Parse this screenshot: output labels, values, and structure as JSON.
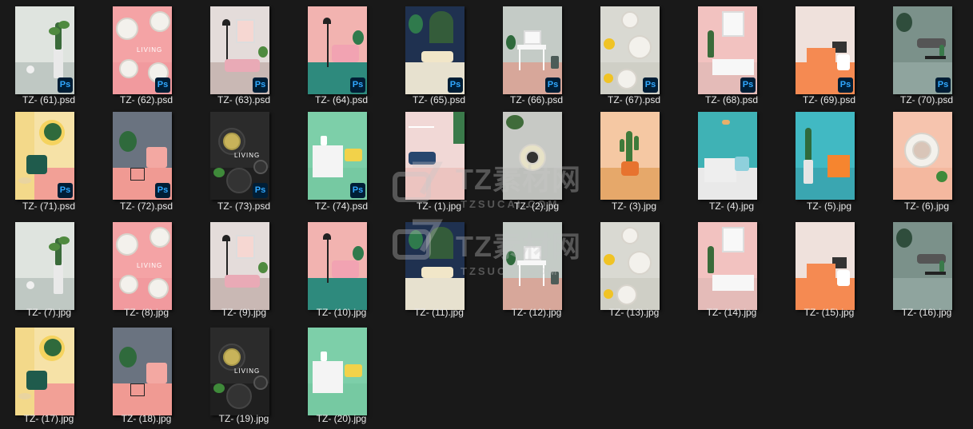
{
  "window": {
    "background": "#191919",
    "watermarks": [
      {
        "logo_text": "TZ素材网",
        "url_text": "TZSUCAI.COM"
      },
      {
        "logo_text": "TZ素材网",
        "url_text": "TZSUCAI.COM"
      }
    ]
  },
  "files": [
    {
      "name": "TZ- (61).psd",
      "type": "psd",
      "theme": "cactus-grey",
      "wall": "#dfe4df",
      "floor": "#bfc8c3",
      "accent": "#3a6b3a"
    },
    {
      "name": "TZ- (62).psd",
      "type": "psd",
      "theme": "plates-pink",
      "wall": "#f4a3a5",
      "floor": "#f19a9e",
      "accent": "#ffffff",
      "caption": "LIVING"
    },
    {
      "name": "TZ- (63).psd",
      "type": "psd",
      "theme": "sofa-pink-room",
      "wall": "#e4dcda",
      "floor": "#c9b8b4",
      "accent": "#e7a8b4"
    },
    {
      "name": "TZ- (64).psd",
      "type": "psd",
      "theme": "armchair-teal",
      "wall": "#f2b3b0",
      "floor": "#2e8a7d",
      "accent": "#f2a3b2"
    },
    {
      "name": "TZ- (65).psd",
      "type": "psd",
      "theme": "navy-arch",
      "wall": "#1f3150",
      "floor": "#e7e1cf",
      "accent": "#d9b35a"
    },
    {
      "name": "TZ- (66).psd",
      "type": "psd",
      "theme": "vanity-grey",
      "wall": "#c4cbc6",
      "floor": "#d7a79a",
      "accent": "#ffffff"
    },
    {
      "name": "TZ- (67).psd",
      "type": "psd",
      "theme": "plates-flowers",
      "wall": "#d9d9d2",
      "floor": "#cfcfc6",
      "accent": "#f0c325"
    },
    {
      "name": "TZ- (68).psd",
      "type": "psd",
      "theme": "pink-frame-desk",
      "wall": "#f2c2c0",
      "floor": "#e4bbb8",
      "accent": "#ffffff"
    },
    {
      "name": "TZ- (69).psd",
      "type": "psd",
      "theme": "orange-desk",
      "wall": "#efe1dc",
      "floor": "#f58a52",
      "accent": "#ffffff"
    },
    {
      "name": "TZ- (70).psd",
      "type": "psd",
      "theme": "sage-lounge",
      "wall": "#7b918a",
      "floor": "#8fa49e",
      "accent": "#2d2d2d"
    },
    {
      "name": "TZ- (71).psd",
      "type": "psd",
      "theme": "yellow-green-chair",
      "wall": "#f6e2a7",
      "floor": "#f2a096",
      "accent": "#1f5b4c"
    },
    {
      "name": "TZ- (72).psd",
      "type": "psd",
      "theme": "grey-pink-chair",
      "wall": "#6a7380",
      "floor": "#f09a93",
      "accent": "#f3a8a2"
    },
    {
      "name": "TZ- (73).psd",
      "type": "psd",
      "theme": "dark-bowls",
      "wall": "#2b2b2b",
      "floor": "#1f1f1f",
      "accent": "#c8b35a",
      "caption": "LIVING"
    },
    {
      "name": "TZ- (74).psd",
      "type": "psd",
      "theme": "mint-desk",
      "wall": "#7dcfa9",
      "floor": "#76c9a2",
      "accent": "#f2d24a"
    },
    {
      "name": "TZ- (1).jpg",
      "type": "jpg",
      "theme": "shelf-pink-blue",
      "wall": "#f1d8d6",
      "floor": "#ecc4c0",
      "accent": "#27466e"
    },
    {
      "name": "TZ- (2).jpg",
      "type": "jpg",
      "theme": "plate-grey",
      "wall": "#c7c9c5",
      "floor": "#bdbfbb",
      "accent": "#e7e2c7"
    },
    {
      "name": "TZ- (3).jpg",
      "type": "jpg",
      "theme": "cactus-peach",
      "wall": "#f5c8a3",
      "floor": "#e6a86a",
      "accent": "#3f7a3a"
    },
    {
      "name": "TZ- (4).jpg",
      "type": "jpg",
      "theme": "teal-marble",
      "wall": "#3fb2b5",
      "floor": "#e9e9e9",
      "accent": "#8fd0dc"
    },
    {
      "name": "TZ- (5).jpg",
      "type": "jpg",
      "theme": "teal-orange",
      "wall": "#41b9c3",
      "floor": "#3aa6b1",
      "accent": "#f6852f"
    },
    {
      "name": "TZ- (6).jpg",
      "type": "jpg",
      "theme": "peach-plate",
      "wall": "#f6c4ae",
      "floor": "#f4b89f",
      "accent": "#ffffff"
    },
    {
      "name": "TZ- (7).jpg",
      "type": "jpg",
      "theme": "cactus-grey",
      "wall": "#dfe4df",
      "floor": "#bfc8c3",
      "accent": "#3a6b3a"
    },
    {
      "name": "TZ- (8).jpg",
      "type": "jpg",
      "theme": "plates-pink",
      "wall": "#f4a3a5",
      "floor": "#f19a9e",
      "accent": "#ffffff",
      "caption": "LIVING"
    },
    {
      "name": "TZ- (9).jpg",
      "type": "jpg",
      "theme": "sofa-pink-room",
      "wall": "#e4dcda",
      "floor": "#c9b8b4",
      "accent": "#e7a8b4"
    },
    {
      "name": "TZ- (10).jpg",
      "type": "jpg",
      "theme": "armchair-teal",
      "wall": "#f2b3b0",
      "floor": "#2e8a7d",
      "accent": "#f2a3b2"
    },
    {
      "name": "TZ- (11).jpg",
      "type": "jpg",
      "theme": "navy-arch",
      "wall": "#1f3150",
      "floor": "#e7e1cf",
      "accent": "#d9b35a"
    },
    {
      "name": "TZ- (12).jpg",
      "type": "jpg",
      "theme": "vanity-grey",
      "wall": "#c4cbc6",
      "floor": "#d7a79a",
      "accent": "#ffffff"
    },
    {
      "name": "TZ- (13).jpg",
      "type": "jpg",
      "theme": "plates-flowers",
      "wall": "#d9d9d2",
      "floor": "#cfcfc6",
      "accent": "#f0c325"
    },
    {
      "name": "TZ- (14).jpg",
      "type": "jpg",
      "theme": "pink-frame-desk",
      "wall": "#f2c2c0",
      "floor": "#e4bbb8",
      "accent": "#ffffff"
    },
    {
      "name": "TZ- (15).jpg",
      "type": "jpg",
      "theme": "orange-desk",
      "wall": "#efe1dc",
      "floor": "#f58a52",
      "accent": "#ffffff"
    },
    {
      "name": "TZ- (16).jpg",
      "type": "jpg",
      "theme": "sage-lounge",
      "wall": "#7b918a",
      "floor": "#8fa49e",
      "accent": "#2d2d2d"
    },
    {
      "name": "TZ- (17).jpg",
      "type": "jpg",
      "theme": "yellow-green-chair",
      "wall": "#f6e2a7",
      "floor": "#f2a096",
      "accent": "#1f5b4c"
    },
    {
      "name": "TZ- (18).jpg",
      "type": "jpg",
      "theme": "grey-pink-chair",
      "wall": "#6a7380",
      "floor": "#f09a93",
      "accent": "#f3a8a2"
    },
    {
      "name": "TZ- (19).jpg",
      "type": "jpg",
      "theme": "dark-bowls",
      "wall": "#2b2b2b",
      "floor": "#1f1f1f",
      "accent": "#c8b35a",
      "caption": "LIVING"
    },
    {
      "name": "TZ- (20).jpg",
      "type": "jpg",
      "theme": "mint-desk",
      "wall": "#7dcfa9",
      "floor": "#76c9a2",
      "accent": "#f2d24a"
    }
  ]
}
